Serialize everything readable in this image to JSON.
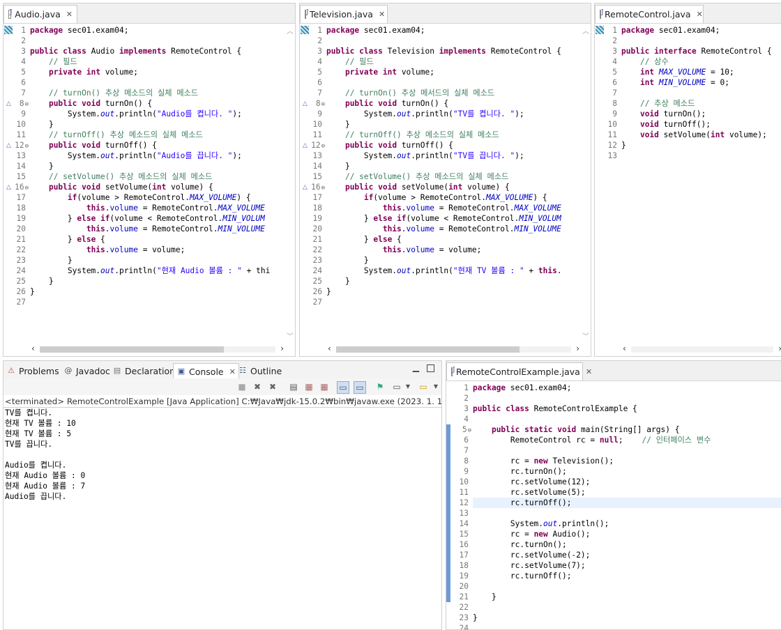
{
  "editors": {
    "audio": {
      "tab_label": "Audio.java",
      "lines": [
        "package sec01.exam04;",
        "",
        "public class Audio implements RemoteControl {",
        "    // 필드",
        "    private int volume;",
        "",
        "    // turnOn() 추상 메소드의 실체 메소드",
        "    public void turnOn() {",
        "        System.out.println(\"Audio를 켭니다. \");",
        "    }",
        "    // turnOff() 추상 메소드의 실체 메소드",
        "    public void turnOff() {",
        "        System.out.println(\"Audio를 끕니다. \");",
        "    }",
        "    // setVolume() 추상 메소드의 실체 메소드",
        "    public void setVolume(int volume) {",
        "        if(volume > RemoteControl.MAX_VOLUME) {",
        "            this.volume = RemoteControl.MAX_VOLUME",
        "        } else if(volume < RemoteControl.MIN_VOLUM",
        "            this.volume = RemoteControl.MIN_VOLUME",
        "        } else {",
        "            this.volume = volume;",
        "        }",
        "        System.out.println(\"현재 Audio 볼륨 : \" + thi",
        "    }",
        "}",
        ""
      ]
    },
    "television": {
      "tab_label": "Television.java",
      "lines": [
        "package sec01.exam04;",
        "",
        "public class Television implements RemoteControl {",
        "    // 필드",
        "    private int volume;",
        "",
        "    // turnOn() 추상 메서드의 실체 메소드",
        "    public void turnOn() {",
        "        System.out.println(\"TV를 켭니다. \");",
        "    }",
        "    // turnOff() 추상 메소드의 실체 메소드",
        "    public void turnOff() {",
        "        System.out.println(\"TV를 끕니다. \");",
        "    }",
        "    // setVolume() 추상 메소드의 실체 메소드",
        "    public void setVolume(int volume) {",
        "        if(volume > RemoteControl.MAX_VOLUME) {",
        "            this.volume = RemoteControl.MAX_VOLUME",
        "        } else if(volume < RemoteControl.MIN_VOLUM",
        "            this.volume = RemoteControl.MIN_VOLUME",
        "        } else {",
        "            this.volume = volume;",
        "        }",
        "        System.out.println(\"현재 TV 볼륨 : \" + this.",
        "    }",
        "}",
        ""
      ]
    },
    "remote": {
      "tab_label": "RemoteControl.java",
      "lines": [
        "package sec01.exam04;",
        "",
        "public interface RemoteControl {",
        "    // 상수",
        "    int MAX_VOLUME = 10;",
        "    int MIN_VOLUME = 0;",
        "",
        "    // 추상 메소드",
        "    void turnOn();",
        "    void turnOff();",
        "    void setVolume(int volume);",
        "}",
        ""
      ]
    },
    "example": {
      "tab_label": "RemoteControlExample.java",
      "lines": [
        "package sec01.exam04;",
        "",
        "public class RemoteControlExample {",
        "",
        "    public static void main(String[] args) {",
        "        RemoteControl rc = null;    // 인터페이스 변수",
        "",
        "        rc = new Television();",
        "        rc.turnOn();",
        "        rc.setVolume(12);",
        "        rc.setVolume(5);",
        "        rc.turnOff();",
        "",
        "        System.out.println();",
        "        rc = new Audio();",
        "        rc.turnOn();",
        "        rc.setVolume(-2);",
        "        rc.setVolume(7);",
        "        rc.turnOff();",
        "",
        "    }",
        "",
        "}",
        ""
      ]
    }
  },
  "bottom_panel": {
    "tabs": {
      "problems": "Problems",
      "javadoc": "Javadoc",
      "declaration": "Declaration",
      "console": "Console",
      "outline": "Outline"
    },
    "console_header": "<terminated> RemoteControlExample [Java Application] C:₩Java₩jdk-15.0.2₩bin₩javaw.exe  (2023. 1. 16. 오후 5:39",
    "console_output": [
      "TV를 켭니다.",
      "현재 TV 볼륨 : 10",
      "현재 TV 볼륨 : 5",
      "TV를 끕니다.",
      "",
      "Audio를 켭니다.",
      "현재 Audio 볼륨 : 0",
      "현재 Audio 볼륨 : 7",
      "Audio를 끕니다."
    ]
  }
}
